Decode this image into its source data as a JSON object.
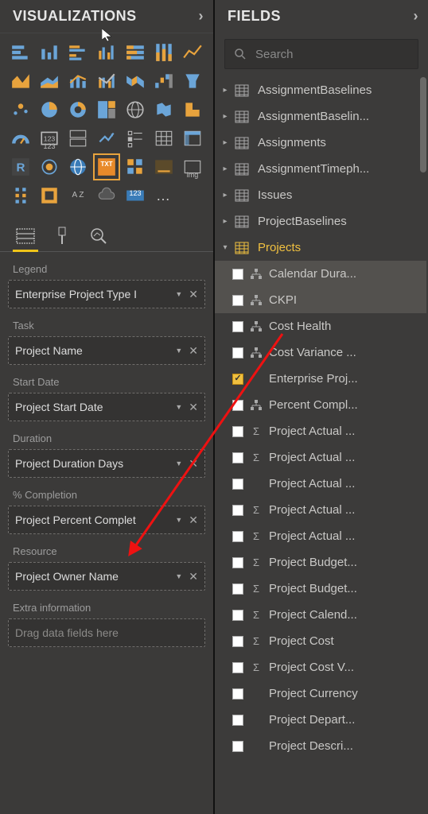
{
  "visualizations": {
    "title": "VISUALIZATIONS",
    "tabs": [
      "fields",
      "format",
      "analytics"
    ],
    "wells": [
      {
        "label": "Legend",
        "value": "Enterprise Project Type I",
        "placeholder": ""
      },
      {
        "label": "Task",
        "value": "Project Name",
        "placeholder": ""
      },
      {
        "label": "Start Date",
        "value": "Project Start Date",
        "placeholder": ""
      },
      {
        "label": "Duration",
        "value": "Project Duration Days",
        "placeholder": ""
      },
      {
        "label": "% Completion",
        "value": "Project Percent Complet",
        "placeholder": ""
      },
      {
        "label": "Resource",
        "value": "Project Owner Name",
        "placeholder": ""
      },
      {
        "label": "Extra information",
        "value": "",
        "placeholder": "Drag data fields here"
      }
    ],
    "custom_labels": {
      "img": "img",
      "txt": "TXT",
      "r": "R",
      "num": "123",
      "az": "A Z"
    }
  },
  "fields": {
    "title": "FIELDS",
    "search_placeholder": "Search",
    "tables": [
      {
        "name": "AssignmentBaselines",
        "expanded": false
      },
      {
        "name": "AssignmentBaselin...",
        "expanded": false
      },
      {
        "name": "Assignments",
        "expanded": false
      },
      {
        "name": "AssignmentTimeph...",
        "expanded": false
      },
      {
        "name": "Issues",
        "expanded": false
      },
      {
        "name": "ProjectBaselines",
        "expanded": false
      },
      {
        "name": "Projects",
        "expanded": true,
        "fields": [
          {
            "label": "Calendar Dura...",
            "checked": false,
            "icon": "hierarchy",
            "hl": true
          },
          {
            "label": "CKPI",
            "checked": false,
            "icon": "hierarchy",
            "hl": true
          },
          {
            "label": "Cost Health",
            "checked": false,
            "icon": "hierarchy",
            "hl": false
          },
          {
            "label": "Cost Variance ...",
            "checked": false,
            "icon": "hierarchy",
            "hl": false
          },
          {
            "label": "Enterprise Proj...",
            "checked": true,
            "icon": "none",
            "hl": false
          },
          {
            "label": "Percent Compl...",
            "checked": false,
            "icon": "hierarchy",
            "hl": false
          },
          {
            "label": "Project Actual ...",
            "checked": false,
            "icon": "sigma",
            "hl": false
          },
          {
            "label": "Project Actual ...",
            "checked": false,
            "icon": "sigma",
            "hl": false
          },
          {
            "label": "Project Actual ...",
            "checked": false,
            "icon": "none",
            "hl": false
          },
          {
            "label": "Project Actual ...",
            "checked": false,
            "icon": "sigma",
            "hl": false
          },
          {
            "label": "Project Actual ...",
            "checked": false,
            "icon": "sigma",
            "hl": false
          },
          {
            "label": "Project Budget...",
            "checked": false,
            "icon": "sigma",
            "hl": false
          },
          {
            "label": "Project Budget...",
            "checked": false,
            "icon": "sigma",
            "hl": false
          },
          {
            "label": "Project Calend...",
            "checked": false,
            "icon": "sigma",
            "hl": false
          },
          {
            "label": "Project Cost",
            "checked": false,
            "icon": "sigma",
            "hl": false
          },
          {
            "label": "Project Cost V...",
            "checked": false,
            "icon": "sigma",
            "hl": false
          },
          {
            "label": "Project Currency",
            "checked": false,
            "icon": "none",
            "hl": false
          },
          {
            "label": "Project Depart...",
            "checked": false,
            "icon": "none",
            "hl": false
          },
          {
            "label": "Project Descri...",
            "checked": false,
            "icon": "none",
            "hl": false
          }
        ]
      }
    ]
  }
}
